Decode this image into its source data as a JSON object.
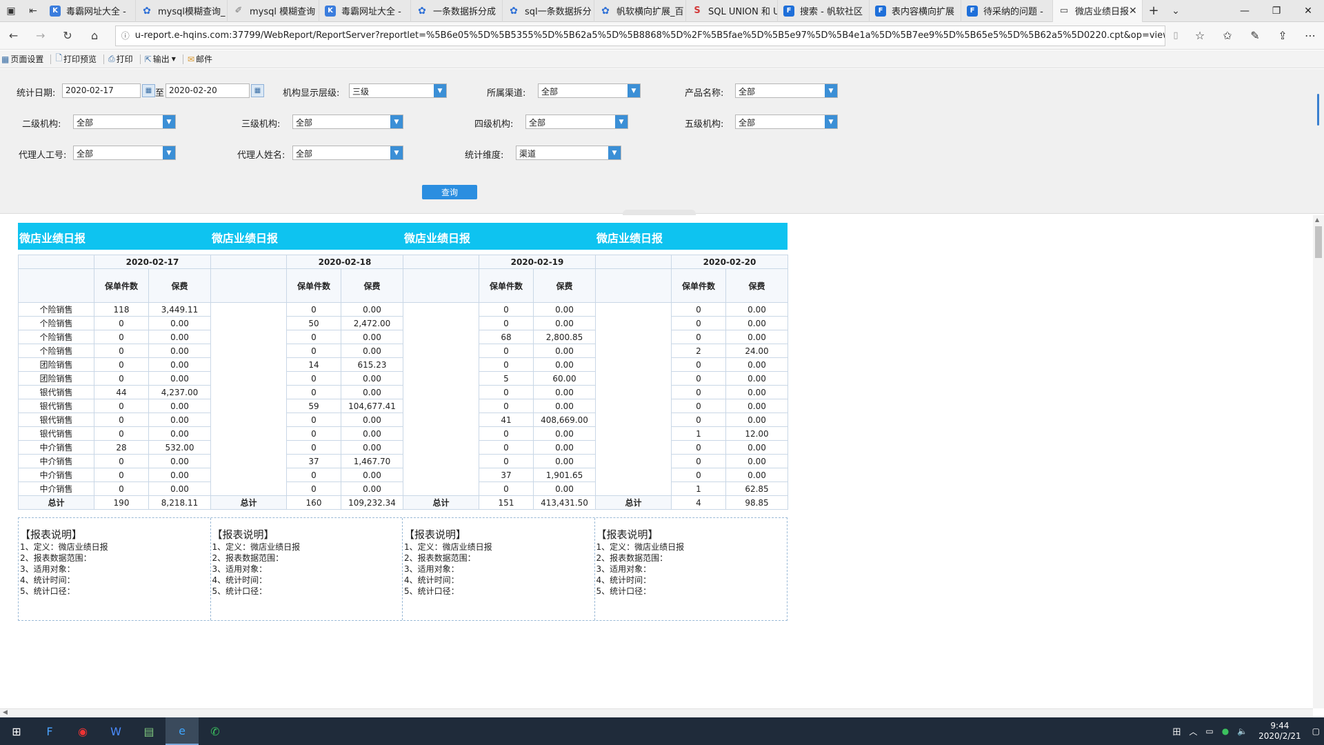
{
  "browser": {
    "tabs": [
      {
        "label": "毒霸网址大全 -",
        "icon": "k-icon",
        "color": "#3b7ddd"
      },
      {
        "label": "mysql模糊查询_",
        "icon": "baidu-paw-icon",
        "color": "#2d6fd6"
      },
      {
        "label": "mysql 模糊查询",
        "icon": "feather-icon",
        "color": "#777777"
      },
      {
        "label": "毒霸网址大全 -",
        "icon": "k-icon",
        "color": "#3b7ddd"
      },
      {
        "label": "一条数据拆分成",
        "icon": "baidu-paw-icon",
        "color": "#2d6fd6"
      },
      {
        "label": "sql一条数据拆分",
        "icon": "baidu-paw-icon",
        "color": "#2d6fd6"
      },
      {
        "label": "帆软横向扩展_百",
        "icon": "baidu-paw-icon",
        "color": "#2d6fd6"
      },
      {
        "label": "SQL UNION 和 U",
        "icon": "runoob-icon",
        "color": "#d23a3a"
      },
      {
        "label": "搜索 - 帆软社区",
        "icon": "fanruan-icon",
        "color": "#1e6fd9"
      },
      {
        "label": "表内容横向扩展",
        "icon": "fanruan-icon",
        "color": "#1e6fd9"
      },
      {
        "label": "待采纳的问题 -",
        "icon": "fanruan-icon",
        "color": "#1e6fd9"
      },
      {
        "label": "微店业绩日报",
        "icon": "page-icon",
        "color": "#444444"
      }
    ],
    "url": "u-report.e-hqins.com:37799/WebReport/ReportServer?reportlet=%5B6e05%5D%5B5355%5D%5B62a5%5D%5B8868%5D%2F%5B5fae%5D%5B5e97%5D%5B4e1a%5D%5B7ee9%5D%5B65e5%5D%5B62a5%5D0220.cpt&op=view&fr_check_url=FriFeb2109:42:07CS"
  },
  "toolbar": {
    "page_setup": "页面设置",
    "print_preview": "打印预览",
    "print": "打印",
    "export": "输出",
    "mail": "邮件"
  },
  "params": {
    "date_label": "统计日期:",
    "date_from": "2020-02-17",
    "date_sep": "至",
    "date_to": "2020-02-20",
    "org_level_label": "机构显示层级:",
    "org_level": "三级",
    "channel_label": "所属渠道:",
    "channel": "全部",
    "product_label": "产品名称:",
    "product": "全部",
    "org2_label": "二级机构:",
    "org2": "全部",
    "org3_label": "三级机构:",
    "org3": "全部",
    "org4_label": "四级机构:",
    "org4": "全部",
    "org5_label": "五级机构:",
    "org5": "全部",
    "agent_id_label": "代理人工号:",
    "agent_id": "全部",
    "agent_name_label": "代理人姓名:",
    "agent_name": "全部",
    "dimension_label": "统计维度:",
    "dimension": "渠道",
    "query_button": "查询"
  },
  "report": {
    "title": "微店业绩日报",
    "col_count": "保单件数",
    "col_premium": "保费",
    "total_label": "总计",
    "blocks": [
      {
        "date": "2020-02-17",
        "rows": [
          [
            "个险销售",
            "118",
            "3,449.11"
          ],
          [
            "个险销售",
            "0",
            "0.00"
          ],
          [
            "个险销售",
            "0",
            "0.00"
          ],
          [
            "个险销售",
            "0",
            "0.00"
          ],
          [
            "团险销售",
            "0",
            "0.00"
          ],
          [
            "团险销售",
            "0",
            "0.00"
          ],
          [
            "银代销售",
            "44",
            "4,237.00"
          ],
          [
            "银代销售",
            "0",
            "0.00"
          ],
          [
            "银代销售",
            "0",
            "0.00"
          ],
          [
            "银代销售",
            "0",
            "0.00"
          ],
          [
            "中介销售",
            "28",
            "532.00"
          ],
          [
            "中介销售",
            "0",
            "0.00"
          ],
          [
            "中介销售",
            "0",
            "0.00"
          ],
          [
            "中介销售",
            "0",
            "0.00"
          ]
        ],
        "total": [
          "190",
          "8,218.11"
        ]
      },
      {
        "date": "2020-02-18",
        "rows": [
          [
            "",
            "0",
            "0.00"
          ],
          [
            "",
            "50",
            "2,472.00"
          ],
          [
            "",
            "0",
            "0.00"
          ],
          [
            "",
            "0",
            "0.00"
          ],
          [
            "",
            "14",
            "615.23"
          ],
          [
            "",
            "0",
            "0.00"
          ],
          [
            "",
            "0",
            "0.00"
          ],
          [
            "",
            "59",
            "104,677.41"
          ],
          [
            "",
            "0",
            "0.00"
          ],
          [
            "",
            "0",
            "0.00"
          ],
          [
            "",
            "0",
            "0.00"
          ],
          [
            "",
            "37",
            "1,467.70"
          ],
          [
            "",
            "0",
            "0.00"
          ],
          [
            "",
            "0",
            "0.00"
          ]
        ],
        "total": [
          "160",
          "109,232.34"
        ]
      },
      {
        "date": "2020-02-19",
        "rows": [
          [
            "",
            "0",
            "0.00"
          ],
          [
            "",
            "0",
            "0.00"
          ],
          [
            "",
            "68",
            "2,800.85"
          ],
          [
            "",
            "0",
            "0.00"
          ],
          [
            "",
            "0",
            "0.00"
          ],
          [
            "",
            "5",
            "60.00"
          ],
          [
            "",
            "0",
            "0.00"
          ],
          [
            "",
            "0",
            "0.00"
          ],
          [
            "",
            "41",
            "408,669.00"
          ],
          [
            "",
            "0",
            "0.00"
          ],
          [
            "",
            "0",
            "0.00"
          ],
          [
            "",
            "0",
            "0.00"
          ],
          [
            "",
            "37",
            "1,901.65"
          ],
          [
            "",
            "0",
            "0.00"
          ]
        ],
        "total": [
          "151",
          "413,431.50"
        ]
      },
      {
        "date": "2020-02-20",
        "rows": [
          [
            "",
            "0",
            "0.00"
          ],
          [
            "",
            "0",
            "0.00"
          ],
          [
            "",
            "0",
            "0.00"
          ],
          [
            "",
            "2",
            "24.00"
          ],
          [
            "",
            "0",
            "0.00"
          ],
          [
            "",
            "0",
            "0.00"
          ],
          [
            "",
            "0",
            "0.00"
          ],
          [
            "",
            "0",
            "0.00"
          ],
          [
            "",
            "0",
            "0.00"
          ],
          [
            "",
            "1",
            "12.00"
          ],
          [
            "",
            "0",
            "0.00"
          ],
          [
            "",
            "0",
            "0.00"
          ],
          [
            "",
            "0",
            "0.00"
          ],
          [
            "",
            "1",
            "62.85"
          ]
        ],
        "total": [
          "4",
          "98.85"
        ]
      }
    ],
    "notes": {
      "title": "【报表说明】",
      "lines": [
        "1、定义：微店业绩日报",
        "2、报表数据范围：",
        "3、适用对象：",
        "4、统计时间：",
        "5、统计口径："
      ]
    }
  },
  "taskbar": {
    "time": "9:44",
    "date": "2020/2/21"
  }
}
